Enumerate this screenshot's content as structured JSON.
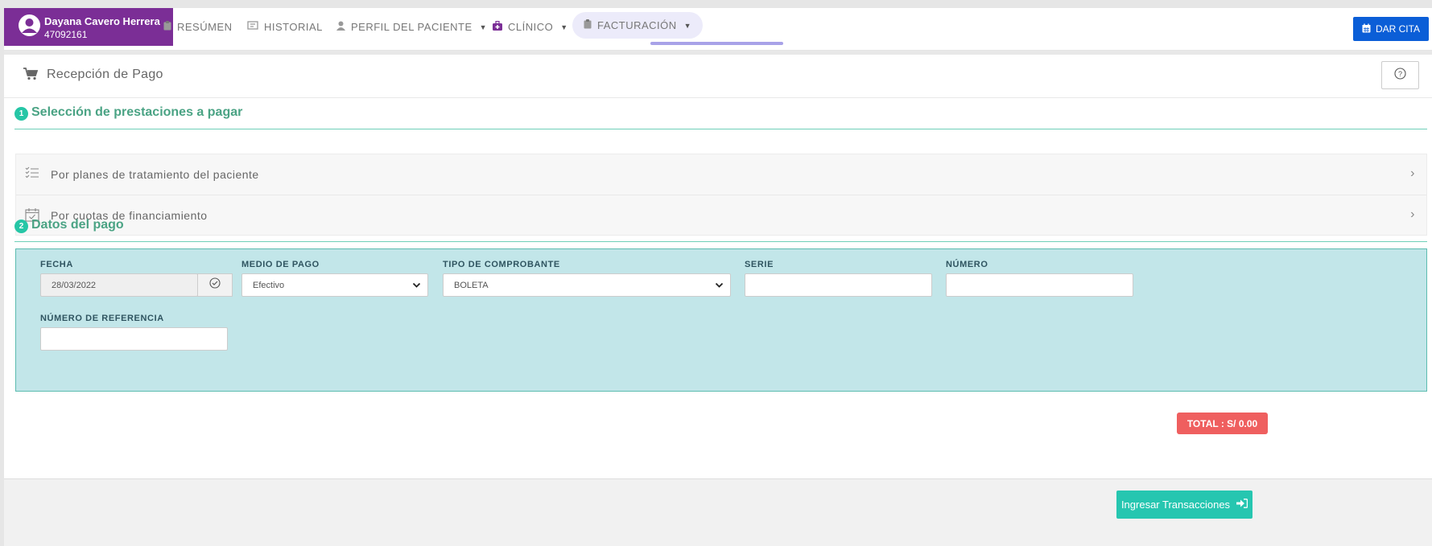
{
  "patient": {
    "name": "Dayana Cavero Herrera",
    "id": "47092161"
  },
  "nav": {
    "items": [
      {
        "label": "RESÚMEN",
        "icon": "clipboard-icon"
      },
      {
        "label": "HISTORIAL",
        "icon": "history-icon"
      },
      {
        "label": "PERFIL DEL PACIENTE",
        "icon": "user-icon",
        "dropdown": true
      },
      {
        "label": "CLÍNICO",
        "icon": "medical-bag-icon",
        "dropdown": true
      },
      {
        "label": "FACTURACIÓN",
        "icon": "clipboard-icon",
        "dropdown": true,
        "active": true
      }
    ],
    "cta_label": "DAR CITA"
  },
  "card": {
    "title": "Recepción de Pago",
    "help_icon": "question-icon"
  },
  "steps": [
    {
      "num": "1",
      "title": "Selección de prestaciones a pagar"
    },
    {
      "num": "2",
      "title": "Datos del pago"
    }
  ],
  "accordion": [
    {
      "label": "Por planes de tratamiento del paciente",
      "icon": "checklist-icon"
    },
    {
      "label": "Por cuotas de financiamiento",
      "icon": "calendar-check-icon"
    }
  ],
  "form": {
    "fecha_label": "FECHA",
    "fecha_value": "28/03/2022",
    "medio_label": "MEDIO DE PAGO",
    "medio_value": "Efectivo",
    "tipo_label": "TIPO DE COMPROBANTE",
    "tipo_value": "BOLETA",
    "serie_label": "SERIE",
    "serie_value": "",
    "numero_label": "NÚMERO",
    "numero_value": "",
    "referencia_label": "NÚMERO DE REFERENCIA",
    "referencia_value": ""
  },
  "total_label": "TOTAL : S/ 0.00",
  "submit_label": "Ingresar Transacciones",
  "colors": {
    "patient_bg": "#7b2e96",
    "accent": "#26c6b0",
    "primary": "#0b5ed7",
    "danger": "#ef5f5f"
  }
}
